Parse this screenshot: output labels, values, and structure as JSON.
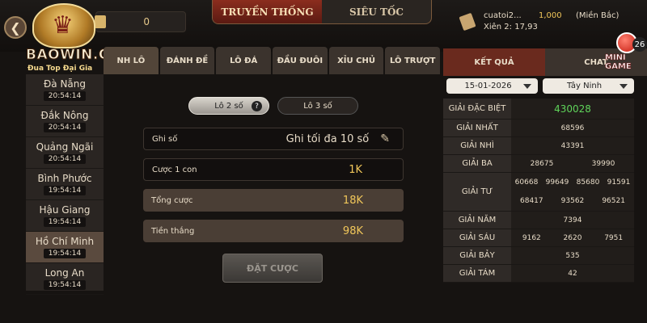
{
  "header": {
    "balance": "0",
    "mode_tabs": [
      {
        "label": "TRUYỀN THỐNG",
        "active": true
      },
      {
        "label": "SIÊU TỐC",
        "active": false
      }
    ],
    "user": {
      "name": "cuatoi2...",
      "xien": "Xiên 2: 17,93",
      "money": "1,000",
      "region": "(Miền Bắc)"
    }
  },
  "logo": {
    "text": "BAOWIN.ORG",
    "subtitle": "Đua Top Đại Gia"
  },
  "mini_game": {
    "label": "MINI GAME",
    "count": "26"
  },
  "cities": [
    {
      "name": "Đà Nẵng",
      "time": "20:54:14"
    },
    {
      "name": "Đắk Nông",
      "time": "20:54:14"
    },
    {
      "name": "Quảng Ngãi",
      "time": "20:54:14"
    },
    {
      "name": "Bình Phước",
      "time": "19:54:14"
    },
    {
      "name": "Hậu Giang",
      "time": "19:54:14"
    },
    {
      "name": "Hồ Chí Minh",
      "time": "19:54:14",
      "active": true
    },
    {
      "name": "Long An",
      "time": "19:54:14"
    }
  ],
  "bet_tabs": [
    "NH LÔ",
    "ĐÁNH ĐỀ",
    "LÔ ĐÁ",
    "ĐẦU ĐUÔI",
    "XỈU CHỦ",
    "LÔ TRƯỢT"
  ],
  "sub_tabs": [
    {
      "label": "Lô 2 số",
      "active": true
    },
    {
      "label": "Lô 3 số",
      "active": false
    }
  ],
  "form": {
    "ghi_so_label": "Ghi số",
    "ghi_so_placeholder": "Ghi tối đa 10 số",
    "cuoc_label": "Cược 1 con",
    "cuoc_value": "1K",
    "tong_label": "Tổng cược",
    "tong_value": "18K",
    "tien_label": "Tiền thắng",
    "tien_value": "98K",
    "submit_label": "ĐẶT CƯỢC"
  },
  "right_panel": {
    "tabs": [
      {
        "label": "KẾT QUẢ",
        "active": true
      },
      {
        "label": "CHAT",
        "active": false
      }
    ],
    "date": "15-01-2026",
    "province": "Tây Ninh",
    "results": [
      {
        "name": "GIẢI ĐẶC BIỆT",
        "values": [
          "430028"
        ],
        "big": true
      },
      {
        "name": "GIẢI NHẤT",
        "values": [
          "68596"
        ]
      },
      {
        "name": "GIẢI NHÌ",
        "values": [
          "43391"
        ]
      },
      {
        "name": "GIẢI BA",
        "values": [
          "28675",
          "39990"
        ]
      },
      {
        "name": "GIẢI TƯ",
        "values": [
          "60668",
          "99649",
          "85680",
          "91591",
          "68417",
          "93562",
          "96521"
        ]
      },
      {
        "name": "GIẢI NĂM",
        "values": [
          "7394"
        ]
      },
      {
        "name": "GIẢI SÁU",
        "values": [
          "9162",
          "2620",
          "7951"
        ]
      },
      {
        "name": "GIẢI BẢY",
        "values": [
          "535"
        ]
      },
      {
        "name": "GIẢI TÁM",
        "values": [
          "42"
        ]
      }
    ]
  }
}
